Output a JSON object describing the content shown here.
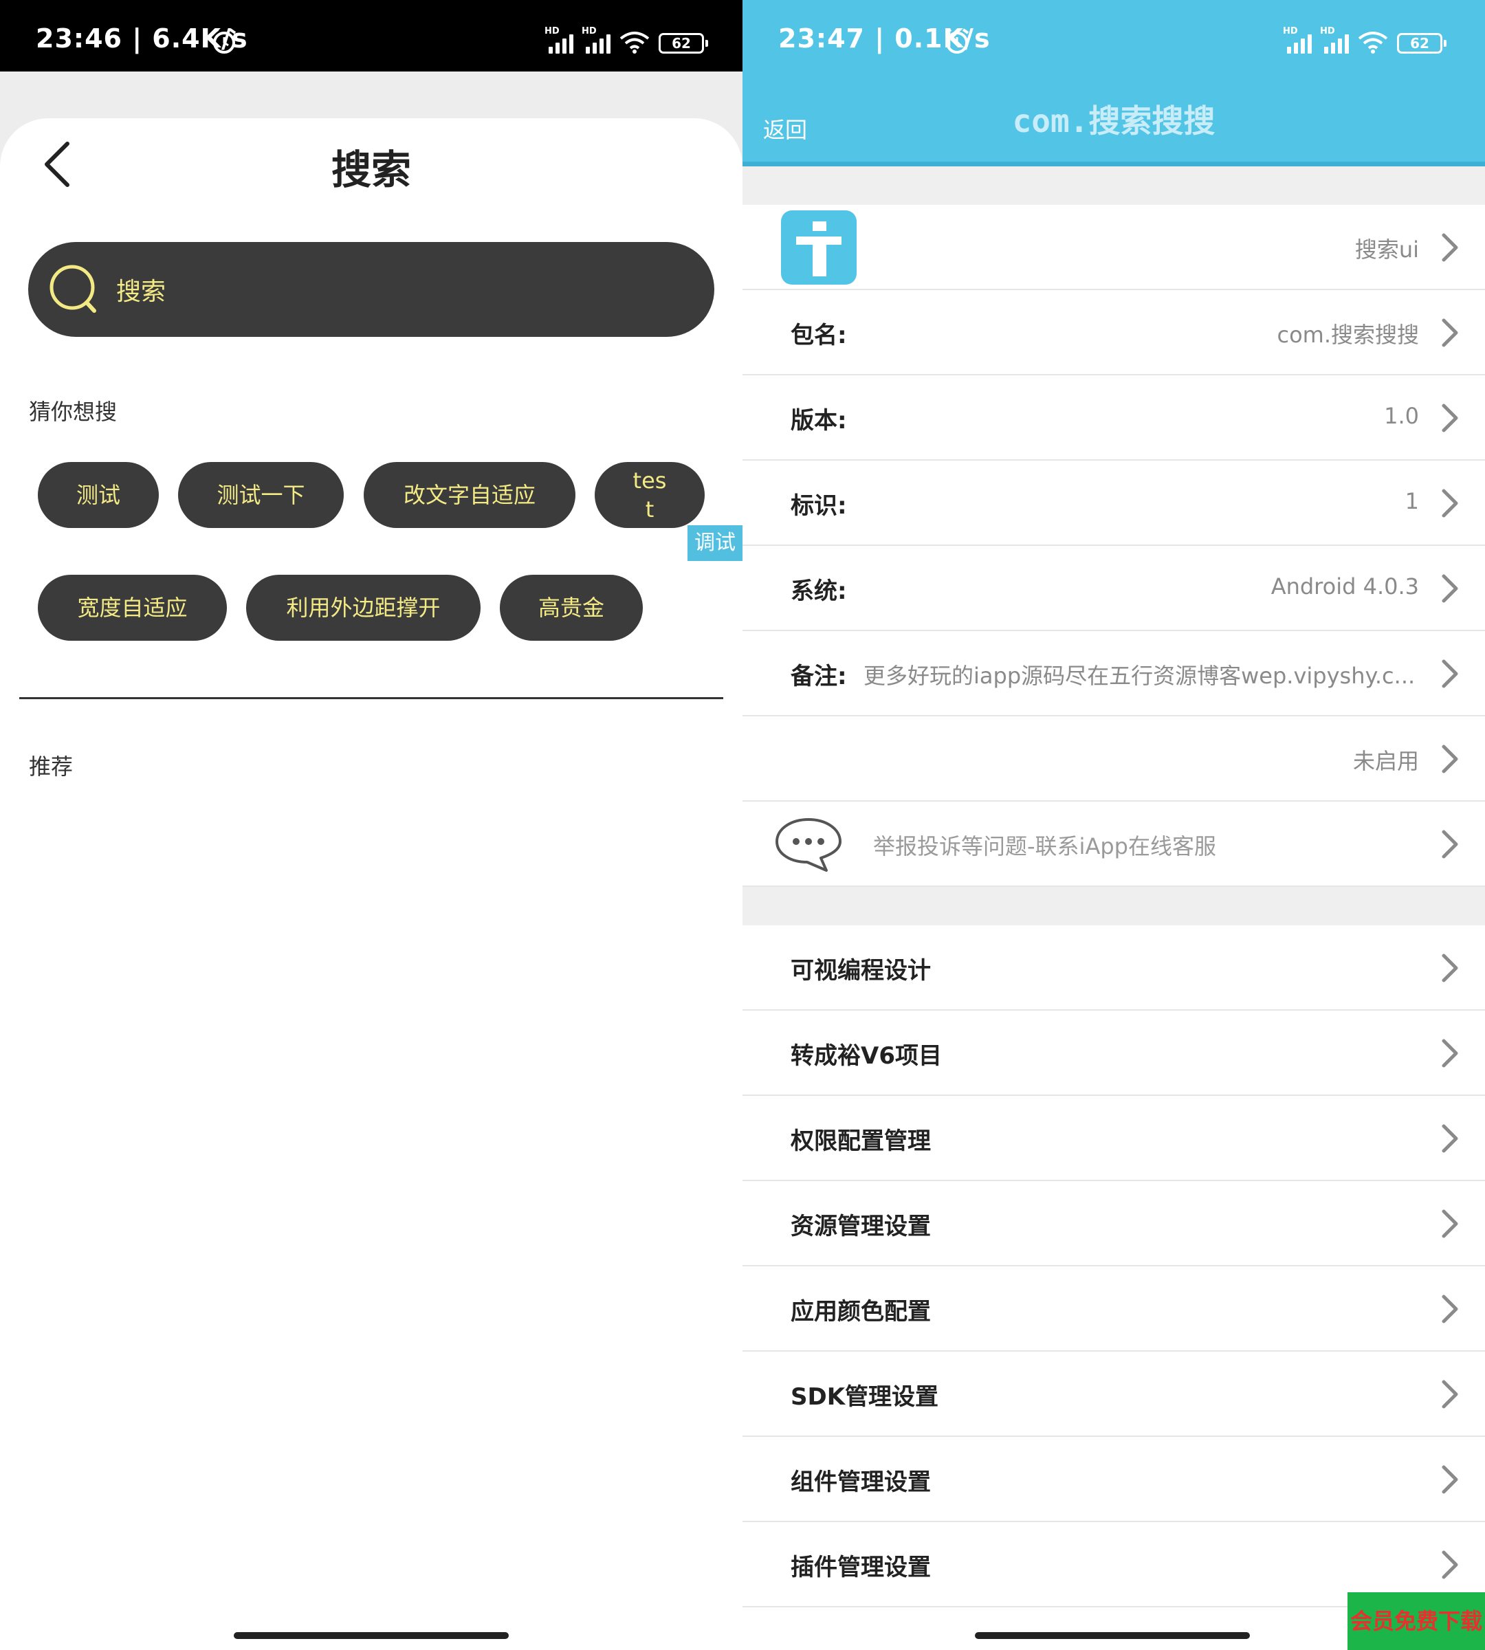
{
  "left": {
    "status": {
      "time": "23:46 | 6.4K/s",
      "battery": "62",
      "hd": "HD"
    },
    "title": "搜索",
    "search": {
      "placeholder": "搜索"
    },
    "guess_label": "猜你想搜",
    "tags": [
      "测试",
      "测试一下",
      "改文字自适应",
      "tes\nt",
      "宽度自适应",
      "利用外边距撑开",
      "高贵金"
    ],
    "debug_badge": "调试",
    "recommend_label": "推荐"
  },
  "right": {
    "status": {
      "time": "23:47 | 0.1K/s",
      "battery": "62",
      "hd": "HD"
    },
    "back_label": "返回",
    "title": "com.搜索搜搜",
    "app_name": "搜索ui",
    "info_rows": [
      {
        "label": "包名:",
        "value": "com.搜索搜搜"
      },
      {
        "label": "版本:",
        "value": "1.0"
      },
      {
        "label": "标识:",
        "value": "1"
      },
      {
        "label": "系统:",
        "value": "Android 4.0.3"
      }
    ],
    "note": {
      "label": "备注:",
      "value": "更多好玩的iapp源码尽在五行资源博客wep.vipyshy.c..."
    },
    "status_value": "未启用",
    "feedback": "举报投诉等问题-联系iApp在线客服",
    "menu": [
      "可视编程设计",
      "转成裕V6项目",
      "权限配置管理",
      "资源管理设置",
      "应用颜色配置",
      "SDK管理设置",
      "组件管理设置",
      "插件管理设置"
    ],
    "watermark": "会员免费下载"
  },
  "colors": {
    "accent": "#52c4e6",
    "tag_bg": "#3b3b3b",
    "tag_text": "#f3ea86"
  },
  "icons": [
    "back-chevron-icon",
    "search-icon",
    "alarm-icon",
    "signal-icon",
    "wifi-icon",
    "battery-icon",
    "chevron-right-icon",
    "info-app-icon",
    "chat-bubble-icon"
  ]
}
